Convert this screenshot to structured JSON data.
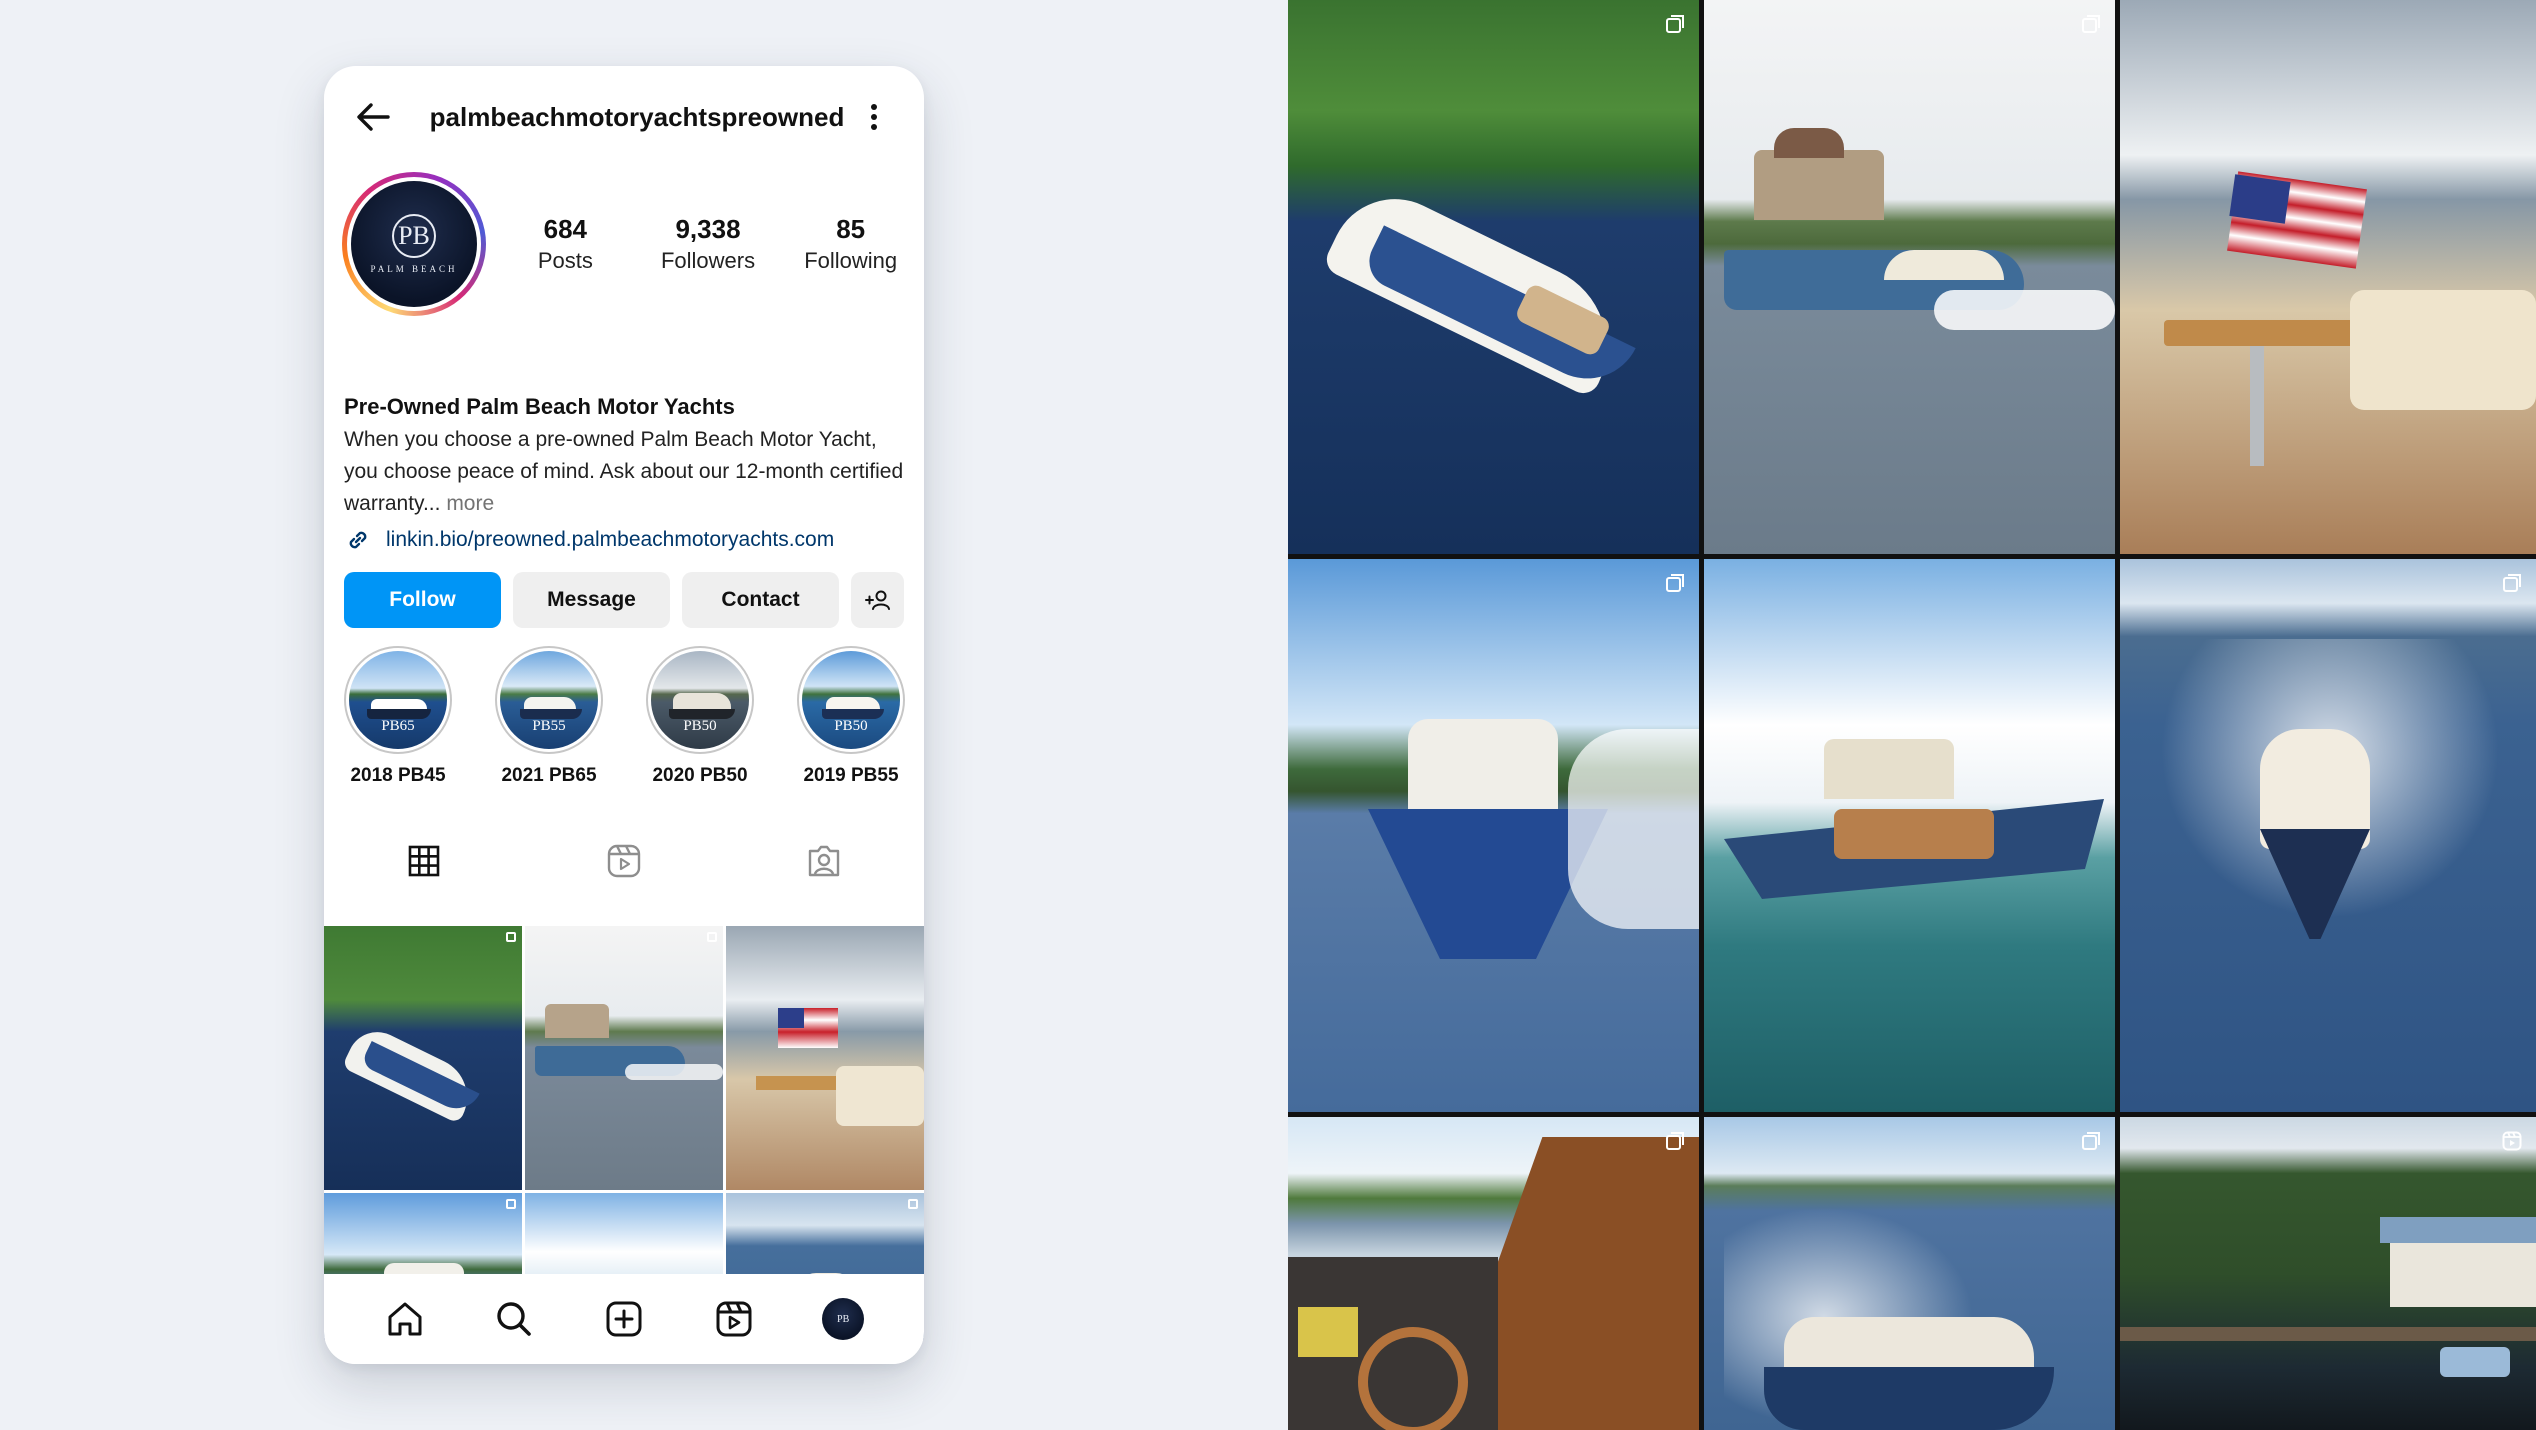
{
  "profile": {
    "username": "palmbeachmotoryachtspreowned",
    "avatar_logo": "PB",
    "avatar_text": "PALM BEACH",
    "stats": [
      {
        "value": "684",
        "label": "Posts"
      },
      {
        "value": "9,338",
        "label": "Followers"
      },
      {
        "value": "85",
        "label": "Following"
      }
    ],
    "name": "Pre-Owned Palm Beach Motor Yachts",
    "bio": "When you choose a pre-owned Palm Beach Motor Yacht, you choose peace of mind. Ask about our 12-month certified warranty...",
    "bio_more": "more",
    "link": "linkin.bio/preowned.palmbeachmotoryachts.com"
  },
  "actions": {
    "follow": "Follow",
    "message": "Message",
    "contact": "Contact",
    "add_person_icon": "add-person-icon"
  },
  "highlights": [
    {
      "label": "2018 PB45",
      "tag": "PB65"
    },
    {
      "label": "2021 PB65",
      "tag": "PB55"
    },
    {
      "label": "2020 PB50",
      "tag": "PB50"
    },
    {
      "label": "2019 PB55",
      "tag": "PB50"
    }
  ],
  "tabs": [
    "grid-icon",
    "reels-icon",
    "tagged-icon"
  ],
  "posts": [
    {
      "name": "yacht-river-aerial",
      "indicator": "carousel-icon"
    },
    {
      "name": "yacht-castle-running",
      "indicator": "carousel-icon"
    },
    {
      "name": "aft-deck-flag",
      "indicator": "none"
    },
    {
      "name": "flybridge-wake",
      "indicator": "carousel-icon"
    },
    {
      "name": "flybridge-anchored",
      "indicator": "none"
    },
    {
      "name": "yacht-head-on-wake",
      "indicator": "carousel-icon"
    },
    {
      "name": "helm-station",
      "indicator": "carousel-icon"
    },
    {
      "name": "yacht-turning",
      "indicator": "carousel-icon"
    },
    {
      "name": "waterfront-home",
      "indicator": "reels-icon"
    }
  ],
  "bottom_nav": [
    "home-icon",
    "search-icon",
    "create-icon",
    "reels-icon",
    "profile-avatar"
  ],
  "colors": {
    "follow_blue": "#0095f6",
    "link_blue": "#00376b",
    "background": "#eef1f6",
    "hull_navy": "#1e3a66"
  }
}
